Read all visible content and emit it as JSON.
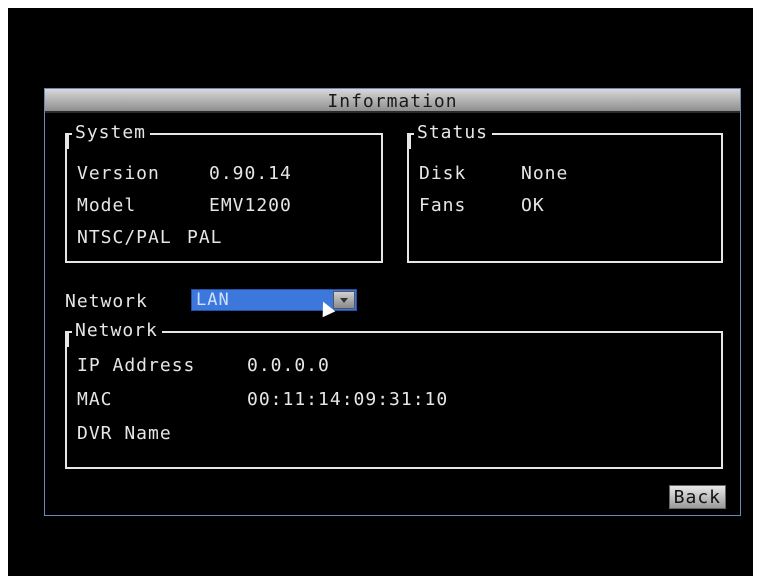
{
  "window": {
    "title": "Information"
  },
  "system": {
    "legend": "System",
    "version_label": "Version",
    "version_value": "0.90.14",
    "model_label": "Model",
    "model_value": "EMV1200",
    "ntsc_label": "NTSC/PAL",
    "ntsc_value": "PAL"
  },
  "status": {
    "legend": "Status",
    "disk_label": "Disk",
    "disk_value": "None",
    "fans_label": "Fans",
    "fans_value": "OK"
  },
  "network_select": {
    "label": "Network",
    "value": "LAN"
  },
  "network": {
    "legend": "Network",
    "ip_label": "IP Address",
    "ip_value": "0.0.0.0",
    "mac_label": "MAC",
    "mac_value": "00:11:14:09:31:10",
    "dvr_label": "DVR Name",
    "dvr_value": ""
  },
  "buttons": {
    "back": "Back"
  },
  "colors": {
    "background": "#000000",
    "frame": "#6f86b8",
    "select": "#3c78dc",
    "text": "#e6e6e6"
  }
}
